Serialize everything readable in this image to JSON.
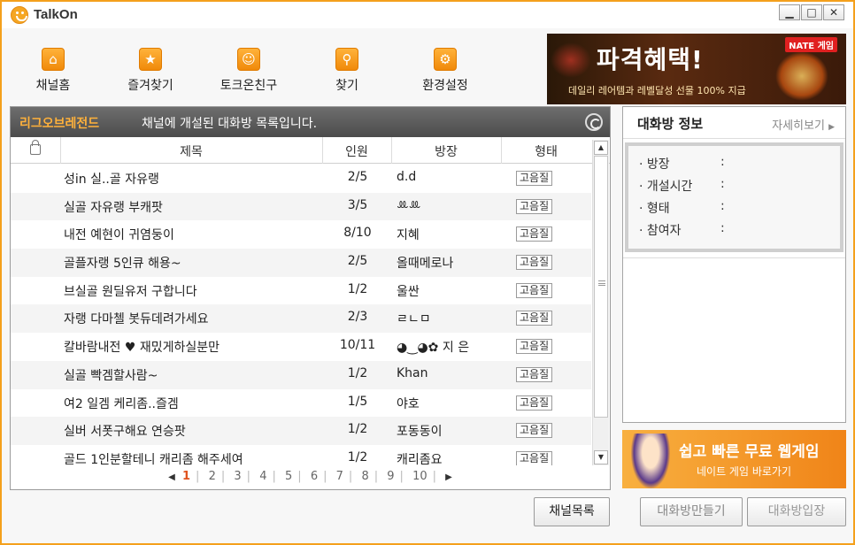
{
  "app": {
    "title": "TalkOn"
  },
  "window_buttons": {
    "minimize": "▁",
    "maximize": "□",
    "close": "✕"
  },
  "toolbar": {
    "items": [
      {
        "label": "채널홈",
        "icon": "channel-home-icon"
      },
      {
        "label": "즐겨찾기",
        "icon": "star-icon"
      },
      {
        "label": "토크온친구",
        "icon": "smiley-icon"
      },
      {
        "label": "찾기",
        "icon": "search-icon"
      },
      {
        "label": "환경설정",
        "icon": "gear-icon"
      }
    ]
  },
  "banner_top": {
    "title": "파격혜택!",
    "subtitle": "데일리 레어템과 레벨달성 선물 100% 지급",
    "brand": "NATE 게임"
  },
  "list": {
    "channel_name": "리그오브레전드",
    "description": "채널에 개설된 대화방 목록입니다.",
    "columns": {
      "title": "제목",
      "count": "인원",
      "owner": "방장",
      "type": "형태"
    },
    "rows": [
      {
        "title": "성in 실..골 자유랭",
        "count": "2/5",
        "owner": "d.d",
        "type": "고음질"
      },
      {
        "title": "실골 자유랭 부캐팟",
        "count": "3/5",
        "owner": "ꔛꔛ",
        "type": "고음질"
      },
      {
        "title": "내전 예현이 귀염둥이",
        "count": "8/10",
        "owner": "지혜",
        "type": "고음질"
      },
      {
        "title": "골플자랭 5인큐 해용~",
        "count": "2/5",
        "owner": "올때메로나",
        "type": "고음질"
      },
      {
        "title": "브실골 원딜유저 구합니다",
        "count": "1/2",
        "owner": "울싼",
        "type": "고음질"
      },
      {
        "title": "자랭 다마첼 봇듀데려가세요",
        "count": "2/3",
        "owner": "ㄹㄴㅁ",
        "type": "고음질"
      },
      {
        "title": "칼바람내전 ♥ 재밌게하실분만",
        "count": "10/11",
        "owner": "◕‿◕✿ 지 은",
        "type": "고음질"
      },
      {
        "title": "실골 빡겜할사람~",
        "count": "1/2",
        "owner": "Khan",
        "type": "고음질"
      },
      {
        "title": "여2 일겜 케리좀..즐겜",
        "count": "1/5",
        "owner": "야호",
        "type": "고음질"
      },
      {
        "title": "실버 서폿구해요 연승팟",
        "count": "1/2",
        "owner": "포동동이",
        "type": "고음질"
      },
      {
        "title": "골드 1인분할테니 캐리좀 해주세여",
        "count": "1/2",
        "owner": "캐리좀요",
        "type": "고음질"
      }
    ],
    "pagination": {
      "prev": "◀",
      "next": "▶",
      "pages": [
        "1",
        "2",
        "3",
        "4",
        "5",
        "6",
        "7",
        "8",
        "9",
        "10"
      ],
      "current": "1"
    }
  },
  "info": {
    "title": "대화방 정보",
    "more": "자세히보기",
    "fields": [
      {
        "label": "· 방장",
        "value": ""
      },
      {
        "label": "· 개설시간",
        "value": ""
      },
      {
        "label": "· 형태",
        "value": ""
      },
      {
        "label": "· 참여자",
        "value": ""
      }
    ]
  },
  "banner_bottom": {
    "title": "쉽고 빠른 무료 웹게임",
    "subtitle": "네이트 게임 바로가기"
  },
  "buttons": {
    "channel_list": "채널목록",
    "create_room": "대화방만들기",
    "enter_room": "대화방입장"
  }
}
